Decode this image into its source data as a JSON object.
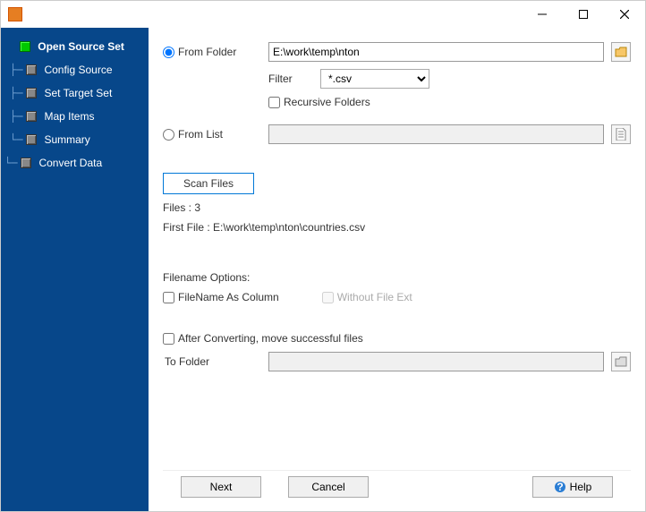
{
  "titlebar": {
    "title": ""
  },
  "sidebar": {
    "items": [
      {
        "label": "Open Source Set"
      },
      {
        "label": "Config Source"
      },
      {
        "label": "Set Target Set"
      },
      {
        "label": "Map Items"
      },
      {
        "label": "Summary"
      },
      {
        "label": "Convert Data"
      }
    ]
  },
  "main": {
    "from_folder_label": "From Folder",
    "from_folder_value": "E:\\work\\temp\\nton",
    "filter_label": "Filter",
    "filter_value": "*.csv",
    "recursive_label": "Recursive Folders",
    "from_list_label": "From List",
    "from_list_value": "",
    "scan_btn": "Scan Files",
    "files_count": "Files : 3",
    "first_file": "First File : E:\\work\\temp\\nton\\countries.csv",
    "filename_options_label": "Filename Options:",
    "filename_as_column": "FileName As Column",
    "without_ext": "Without File Ext",
    "after_converting": "After Converting, move successful files",
    "to_folder_label": "To Folder",
    "to_folder_value": ""
  },
  "footer": {
    "next": "Next",
    "cancel": "Cancel",
    "help": "Help"
  }
}
